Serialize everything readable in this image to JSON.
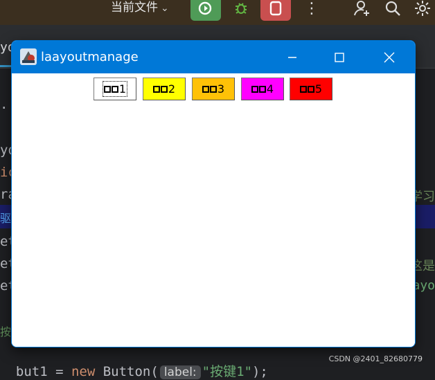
{
  "ide": {
    "current_file": "当前文件",
    "tab_fragment": "yo",
    "code_fragments": {
      "line1": ".",
      "line2": "yo",
      "line3": "ic",
      "line4": "ra",
      "line5": "驱",
      "line6": "et",
      "line7": "et",
      "line8": "et",
      "line9": "按钮"
    },
    "right_fragments": {
      "r1": "学习",
      "r2": "这是",
      "r3": "ayo"
    },
    "bottom_line": {
      "prefix": "but1 = ",
      "keyword": "new",
      "class_call": " Button(",
      "hint_label": "label:",
      "string_arg": "\"按键1\"",
      "suffix": ");"
    },
    "watermark": "CSDN @2401_82680779",
    "colors": {
      "toolbar_bg": "#3b2f1f",
      "editor_bg": "#1e1f22",
      "run": "#4f9b57",
      "stop": "#c94f4f"
    }
  },
  "window": {
    "title": "laayoutmanage",
    "accent": "#0078d7",
    "controls": [
      "minimize-icon",
      "maximize-icon",
      "close-icon"
    ]
  },
  "buttons": [
    {
      "label": "1",
      "color": "#ffffff",
      "focused": true
    },
    {
      "label": "2",
      "color": "#ffff00",
      "focused": false
    },
    {
      "label": "3",
      "color": "#ffc107",
      "focused": false
    },
    {
      "label": "4",
      "color": "#ff00ff",
      "focused": false
    },
    {
      "label": "5",
      "color": "#ff0000",
      "focused": false
    }
  ]
}
